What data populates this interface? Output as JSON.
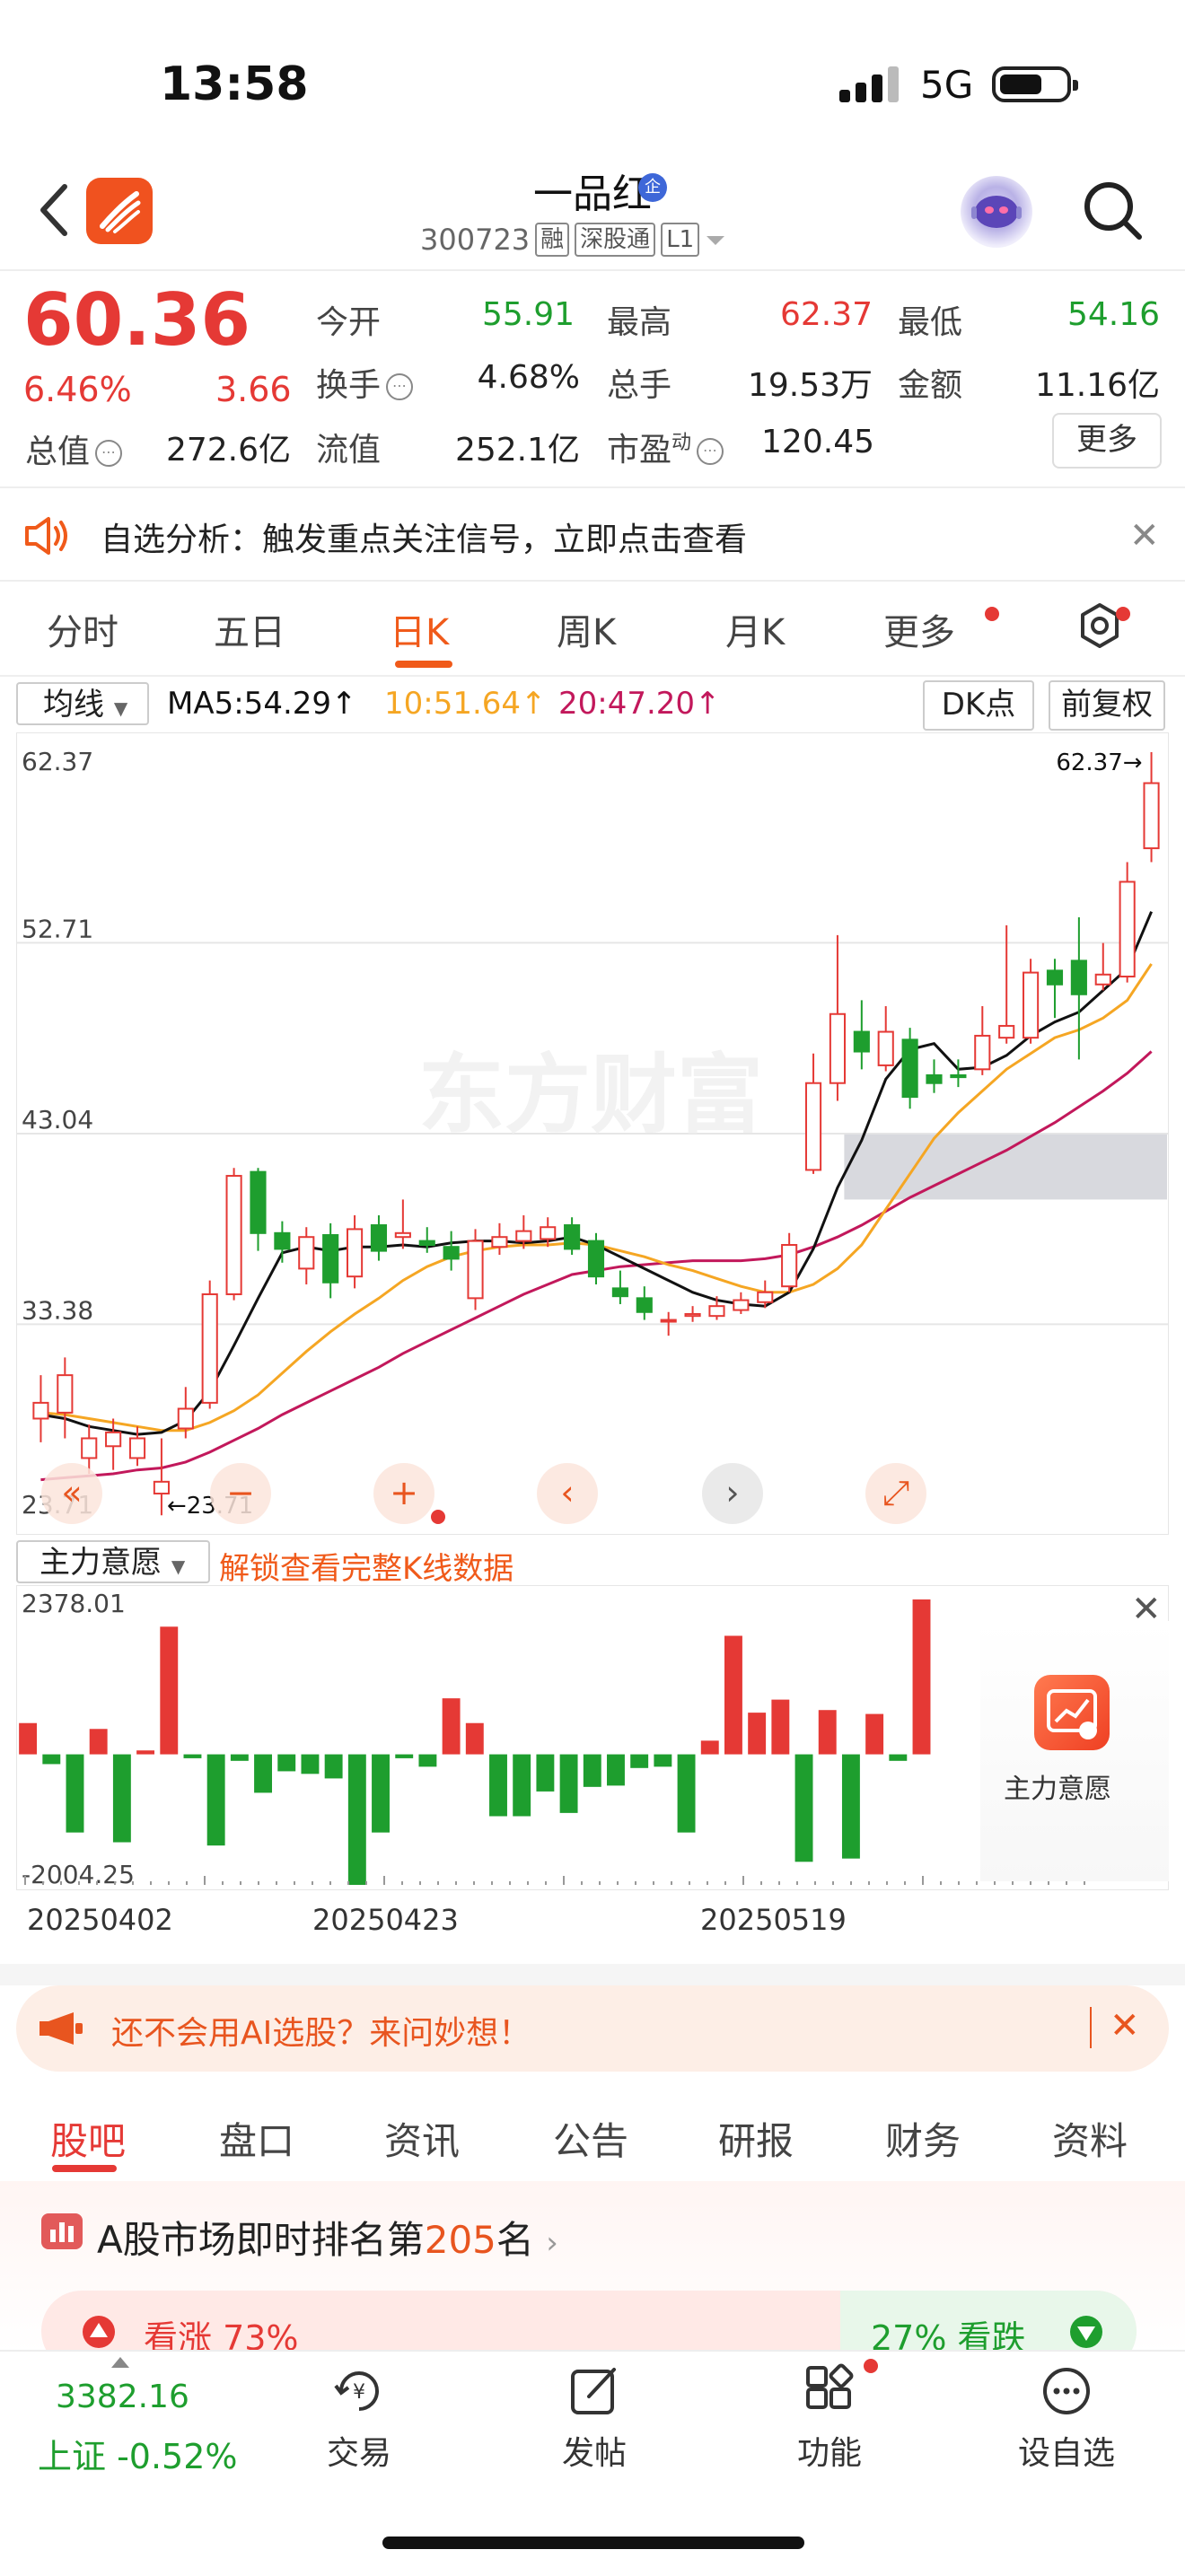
{
  "status": {
    "time": "13:58",
    "network": "5G"
  },
  "header": {
    "title": "一品红",
    "badge": "企",
    "code": "300723",
    "tags": [
      "融",
      "深股通",
      "L1"
    ]
  },
  "quote": {
    "price": "60.36",
    "change_pct": "6.46%",
    "change": "3.66",
    "open_label": "今开",
    "open": "55.91",
    "high_label": "最高",
    "high": "62.37",
    "low_label": "最低",
    "low": "54.16",
    "turnover_label": "换手",
    "turnover": "4.68%",
    "volume_label": "总手",
    "volume": "19.53万",
    "amount_label": "金额",
    "amount": "11.16亿",
    "mktcap_label": "总值",
    "mktcap": "272.6亿",
    "float_label": "流值",
    "float": "252.1亿",
    "pe_label": "市盈",
    "pe_sup": "动",
    "pe": "120.45",
    "more_label": "更多"
  },
  "notice": {
    "text": "自选分析：触发重点关注信号，立即点击查看"
  },
  "period_tabs": [
    "分时",
    "五日",
    "日K",
    "周K",
    "月K",
    "更多"
  ],
  "ma": {
    "select": "均线",
    "ma5": "MA5:54.29↑",
    "ma10": "10:51.64↑",
    "ma20": "20:47.20↑",
    "dk": "DK点",
    "fq": "前复权"
  },
  "indicator": {
    "select": "主力意愿",
    "unlock": "解锁查看完整K线数据",
    "card_label": "主力意愿"
  },
  "dates": [
    "20250402",
    "20250423",
    "20250519"
  ],
  "ai_banner": {
    "text": "还不会用AI选股？来问妙想！"
  },
  "bottom_tabs": [
    "股吧",
    "盘口",
    "资讯",
    "公告",
    "研报",
    "财务",
    "资料"
  ],
  "rank": {
    "prefix": "A股市场即时排名第",
    "num": "205",
    "suffix": "名"
  },
  "sentiment": {
    "bull": "看涨 73%",
    "bear": "27% 看跌"
  },
  "nav": {
    "index_value": "3382.16",
    "index_name": "上证 -0.52%",
    "items": [
      "交易",
      "发帖",
      "功能",
      "设自选"
    ]
  },
  "colors": {
    "up": "#e53935",
    "down": "#1e9e2e",
    "ma5": "#111111",
    "ma10": "#f5a623",
    "ma20": "#c2185b",
    "accent": "#f05a1a"
  },
  "chart_data": [
    {
      "type": "candlestick",
      "title": "",
      "ylim": [
        23.71,
        62.37
      ],
      "y_ticks": [
        "62.37",
        "52.71",
        "43.04",
        "33.38",
        "23.71"
      ],
      "high_mark": "62.37→",
      "low_mark": "←23.71",
      "candles": [
        [
          28.6,
          29.4,
          27.4,
          30.8
        ],
        [
          28.9,
          30.8,
          27.6,
          31.7
        ],
        [
          26.6,
          27.6,
          25.8,
          28.3
        ],
        [
          27.2,
          27.9,
          26.0,
          28.6
        ],
        [
          26.6,
          27.6,
          26.2,
          28.2
        ],
        [
          24.8,
          25.4,
          23.7,
          27.6
        ],
        [
          28.1,
          29.1,
          27.6,
          30.2
        ],
        [
          29.4,
          34.9,
          29.1,
          35.6
        ],
        [
          34.9,
          40.9,
          34.6,
          41.3
        ],
        [
          41.1,
          38.0,
          37.1,
          41.3
        ],
        [
          38.0,
          37.2,
          36.5,
          38.6
        ],
        [
          36.2,
          37.8,
          35.4,
          38.3
        ],
        [
          37.9,
          35.5,
          34.7,
          38.5
        ],
        [
          35.8,
          38.2,
          35.2,
          38.9
        ],
        [
          38.4,
          37.1,
          36.6,
          38.9
        ],
        [
          37.8,
          38.0,
          37.2,
          39.7
        ],
        [
          37.6,
          37.4,
          37.0,
          38.3
        ],
        [
          37.3,
          36.7,
          36.1,
          38.1
        ],
        [
          34.7,
          37.6,
          34.1,
          38.2
        ],
        [
          37.3,
          37.8,
          36.9,
          38.5
        ],
        [
          37.6,
          38.1,
          37.2,
          38.9
        ],
        [
          37.7,
          38.3,
          37.3,
          38.8
        ],
        [
          38.4,
          37.2,
          36.9,
          38.8
        ],
        [
          37.6,
          35.8,
          35.4,
          38.0
        ],
        [
          35.2,
          34.8,
          34.4,
          36.1
        ],
        [
          34.7,
          34.0,
          33.6,
          35.3
        ],
        [
          33.6,
          33.6,
          32.8,
          34.0
        ],
        [
          33.8,
          33.9,
          33.5,
          34.3
        ],
        [
          33.8,
          34.3,
          33.6,
          34.8
        ],
        [
          34.1,
          34.6,
          33.9,
          35.0
        ],
        [
          34.5,
          35.0,
          34.2,
          35.6
        ],
        [
          35.3,
          37.4,
          35.0,
          38.0
        ],
        [
          41.2,
          45.6,
          41.0,
          47.1
        ],
        [
          45.6,
          49.1,
          44.7,
          53.1
        ],
        [
          48.2,
          47.2,
          46.3,
          49.8
        ],
        [
          46.5,
          48.2,
          46.2,
          49.5
        ],
        [
          47.8,
          44.9,
          44.3,
          48.4
        ],
        [
          46.0,
          45.6,
          45.1,
          46.8
        ],
        [
          46.0,
          45.9,
          45.4,
          46.8
        ],
        [
          46.3,
          48.0,
          46.0,
          49.5
        ],
        [
          47.9,
          48.5,
          47.6,
          53.6
        ],
        [
          47.9,
          51.2,
          47.6,
          51.9
        ],
        [
          51.3,
          50.6,
          48.9,
          51.9
        ],
        [
          51.8,
          50.1,
          46.8,
          54.0
        ],
        [
          50.6,
          51.1,
          50.3,
          52.7
        ],
        [
          51.0,
          55.8,
          50.7,
          56.8
        ],
        [
          57.5,
          60.8,
          56.8,
          62.37
        ]
      ],
      "ma5": [
        28.8,
        28.6,
        28.2,
        28.0,
        27.8,
        27.9,
        28.5,
        30.0,
        32.3,
        34.7,
        37.0,
        37.3,
        37.1,
        37.3,
        37.3,
        37.4,
        37.3,
        37.5,
        37.6,
        37.6,
        37.5,
        37.6,
        37.8,
        37.4,
        36.8,
        36.2,
        35.6,
        35.0,
        34.6,
        34.4,
        34.3,
        35.0,
        37.2,
        40.3,
        42.7,
        45.8,
        47.3,
        47.6,
        46.3,
        46.4,
        47.0,
        48.0,
        48.7,
        49.2,
        50.3,
        51.4,
        54.29
      ],
      "ma10": [
        28.9,
        28.8,
        28.6,
        28.4,
        28.2,
        28.0,
        28.0,
        28.4,
        29.0,
        29.8,
        30.9,
        32.0,
        33.0,
        33.9,
        34.7,
        35.6,
        36.3,
        36.8,
        37.1,
        37.3,
        37.4,
        37.4,
        37.5,
        37.4,
        37.1,
        36.8,
        36.4,
        36.1,
        35.7,
        35.3,
        35.0,
        35.0,
        35.4,
        36.2,
        37.4,
        39.2,
        41.0,
        42.8,
        44.1,
        45.2,
        46.3,
        47.1,
        47.9,
        48.3,
        48.9,
        49.8,
        51.64
      ],
      "ma20": [
        25.5,
        25.6,
        25.7,
        25.8,
        26.0,
        26.1,
        26.4,
        26.9,
        27.5,
        28.1,
        28.8,
        29.4,
        30.0,
        30.6,
        31.2,
        31.9,
        32.5,
        33.1,
        33.7,
        34.3,
        34.9,
        35.4,
        35.9,
        36.1,
        36.3,
        36.4,
        36.5,
        36.6,
        36.6,
        36.6,
        36.7,
        36.9,
        37.3,
        37.8,
        38.4,
        39.1,
        39.8,
        40.4,
        41.0,
        41.6,
        42.2,
        42.9,
        43.6,
        44.4,
        45.2,
        46.1,
        47.2
      ],
      "zone": [
        39.7,
        43.0
      ]
    },
    {
      "type": "bar",
      "title": "",
      "ylim": [
        -2004.25,
        2378.01
      ],
      "y_ticks": [
        "2378.01",
        "-2004.25"
      ],
      "values": [
        480,
        -150,
        -1200,
        390,
        -1350,
        60,
        1960,
        -60,
        -1400,
        -100,
        -590,
        -260,
        -300,
        -370,
        -2004.25,
        -1200,
        -60,
        -190,
        860,
        480,
        -950,
        -950,
        -570,
        -900,
        -500,
        -480,
        -210,
        -190,
        -1200,
        210,
        1820,
        640,
        840,
        -1650,
        680,
        -1600,
        620,
        -100,
        2378.01,
        0,
        0
      ]
    }
  ]
}
